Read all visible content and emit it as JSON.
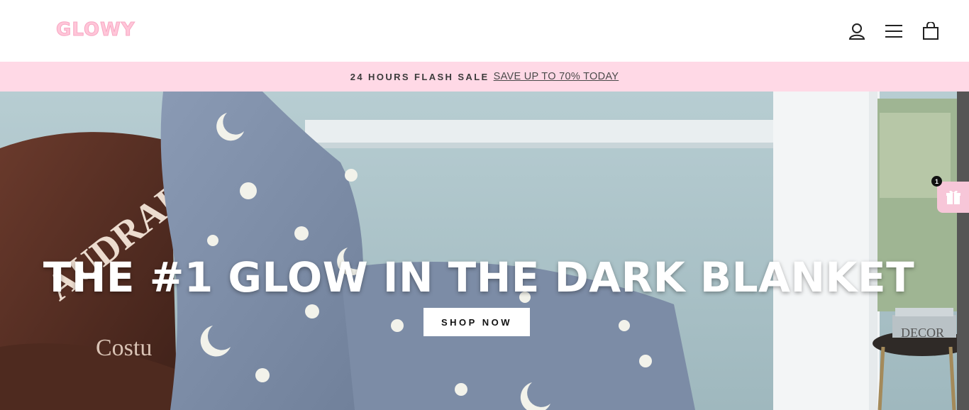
{
  "header": {
    "logo_text": "GLOWY",
    "icons": [
      "account-icon",
      "menu-icon",
      "cart-icon"
    ]
  },
  "announcement": {
    "title": "24 HOURS FLASH SALE",
    "link_text": "SAVE UP TO 70% TODAY"
  },
  "hero": {
    "title": "THE #1 GLOW IN THE DARK BLANKET",
    "cta_label": "SHOP NOW",
    "chair_text_1": "AUDRAP",
    "chair_text_2": "Costu",
    "book_text": "DECOR"
  },
  "gift_widget": {
    "badge_count": "1",
    "icon": "gift-icon"
  },
  "colors": {
    "logo": "#ffc6d9",
    "announcement_bg": "#ffd9e6",
    "gift_widget_bg": "#f7c6d8",
    "text_dark": "#3a3a3a"
  }
}
